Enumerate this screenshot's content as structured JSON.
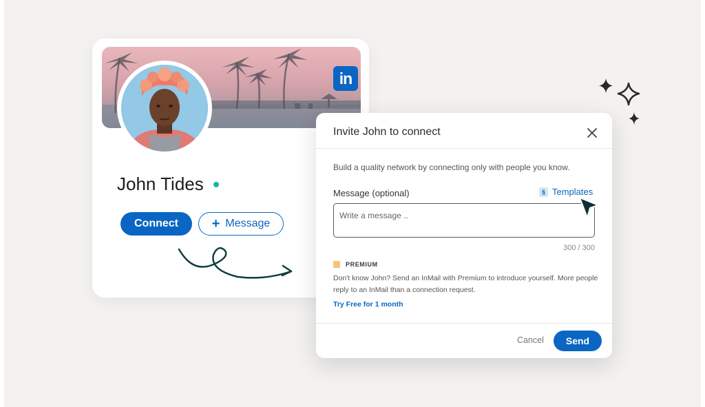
{
  "profile": {
    "name": "John Tides",
    "connect_label": "Connect",
    "message_label": "Message",
    "brand_logo_text": "in",
    "online_status_color": "#1fb5a0",
    "brand_color": "#0a66c2"
  },
  "dialog": {
    "title": "Invite John to connect",
    "subtitle": "Build a quality network by connecting only with people you know.",
    "message_label": "Message (optional)",
    "templates_label": "Templates",
    "templates_icon_glyph": "§",
    "message_placeholder": "Write a message ..",
    "char_count": "300 / 300",
    "premium_label": "PREMIUM",
    "premium_text": "Don't know John? Send an InMail with Premium to introduce yourself. More people reply to an InMail than a connection request.",
    "try_free_label": "Try Free for 1 month",
    "cancel_label": "Cancel",
    "send_label": "Send"
  },
  "icons": {
    "close": "close-icon",
    "plus": "plus-icon",
    "cursor": "cursor-arrow-icon",
    "sparkles": "sparkle-icon",
    "premium": "premium-icon",
    "templates": "template-icon"
  }
}
